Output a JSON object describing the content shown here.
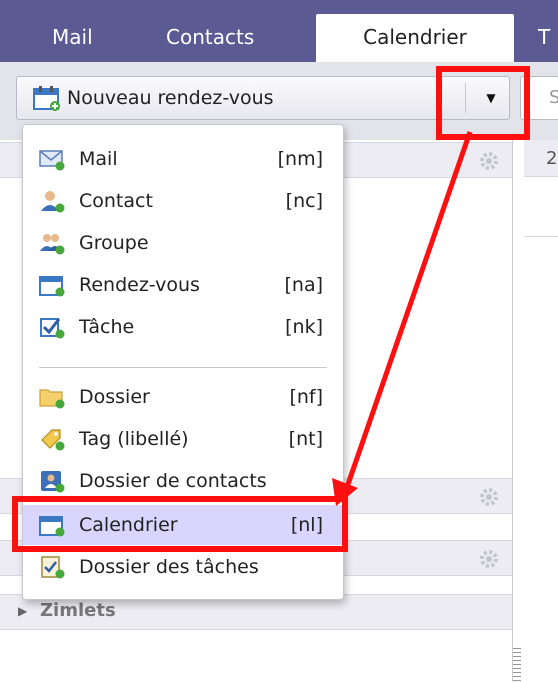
{
  "tabs": [
    {
      "label": "Mail",
      "active": false
    },
    {
      "label": "Contacts",
      "active": false
    },
    {
      "label": "Calendrier",
      "active": true
    },
    {
      "label": "T",
      "active": false
    }
  ],
  "toolbar": {
    "new_label": "Nouveau rendez-vous",
    "search_letter": "S"
  },
  "right_panel": {
    "header_value": "2"
  },
  "menu": {
    "items": [
      {
        "label": "Mail",
        "key": "[nm]",
        "icon": "mail-icon"
      },
      {
        "label": "Contact",
        "key": "[nc]",
        "icon": "contact-icon"
      },
      {
        "label": "Groupe",
        "key": "",
        "icon": "group-icon"
      },
      {
        "label": "Rendez-vous",
        "key": "[na]",
        "icon": "appointment-icon"
      },
      {
        "label": "Tâche",
        "key": "[nk]",
        "icon": "task-icon"
      },
      {
        "label": "Dossier",
        "key": "[nf]",
        "icon": "folder-icon"
      },
      {
        "label": "Tag (libellé)",
        "key": "[nt]",
        "icon": "tag-icon"
      },
      {
        "label": "Dossier de contacts",
        "key": "",
        "icon": "contacts-folder-icon"
      },
      {
        "label": "Calendrier",
        "key": "[nl]",
        "icon": "calendar-icon",
        "highlighted": true
      },
      {
        "label": "Dossier des tâches",
        "key": "",
        "icon": "task-folder-icon"
      }
    ]
  },
  "sidebar": {
    "zimlets_label": "Zimlets"
  },
  "colors": {
    "tab_bar": "#5b5a92",
    "highlight": "#d8d6ff",
    "annotation_red": "#ff1010"
  }
}
